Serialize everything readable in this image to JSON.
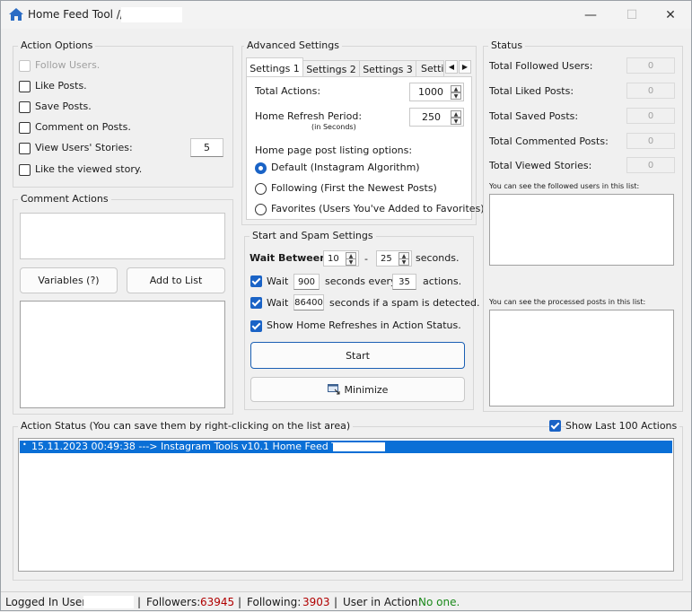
{
  "window": {
    "title": "Home Feed Tool // ",
    "icon": "home-icon",
    "minimize": "—",
    "maximize": "☐",
    "close": "✕"
  },
  "action_options": {
    "title": "Action Options",
    "follow_users": "Follow Users.",
    "like_posts": "Like Posts.",
    "save_posts": "Save Posts.",
    "comment_posts": "Comment on Posts.",
    "view_stories": "View Users' Stories:",
    "stories_count": "5",
    "like_viewed_story": "Like the viewed story."
  },
  "comment_actions": {
    "title": "Comment Actions",
    "variables_button": "Variables (?)",
    "add_to_list_button": "Add to List"
  },
  "advanced": {
    "title": "Advanced Settings",
    "tabs": [
      "Settings 1",
      "Settings 2",
      "Settings 3",
      "Setti"
    ],
    "total_actions_label": "Total Actions:",
    "total_actions_value": "1000",
    "home_refresh_label": "Home Refresh Period:",
    "home_refresh_sub": "(in Seconds)",
    "home_refresh_value": "250",
    "listing_label": "Home page post listing options:",
    "opt_default": "Default (Instagram Algorithm)",
    "opt_following": "Following (First the Newest Posts)",
    "opt_favorites": "Favorites (Users You've Added to Favorites)"
  },
  "spam": {
    "title": "Start and Spam Settings",
    "wait_between": "Wait Between:",
    "min": "10",
    "dash": "-",
    "max": "25",
    "seconds": "seconds.",
    "wait1": "Wait",
    "wait1_value": "900",
    "every": "seconds every",
    "every_value": "35",
    "actions": "actions.",
    "wait2": "Wait",
    "wait2_value": "86400",
    "spam_text": "seconds if a spam is detected.",
    "show_refreshes": "Show Home Refreshes in Action Status.",
    "start_button": "Start",
    "minimize_button": "Minimize"
  },
  "status": {
    "title": "Status",
    "followed_label": "Total Followed Users:",
    "followed": "0",
    "liked_label": "Total Liked Posts:",
    "liked": "0",
    "saved_label": "Total Saved Posts:",
    "saved": "0",
    "commented_label": "Total Commented Posts:",
    "commented": "0",
    "viewed_label": "Total Viewed Stories:",
    "viewed": "0",
    "followed_list_caption": "You can see the followed users in this list:",
    "processed_list_caption": "You can see the processed posts in this list:"
  },
  "action_status": {
    "title": "Action Status (You can save them by right-clicking on the list area)",
    "show_last": "Show Last 100 Actions",
    "entries": [
      "15.11.2023 00:49:38 ---> Instagram Tools v10.1 Home Feed Tool // "
    ]
  },
  "statusbar": {
    "logged_label": "Logged In User:",
    "sep": "|",
    "followers_label": "Followers:",
    "followers": "63945",
    "following_label": "Following:",
    "following": "3903",
    "in_action_label": "User in Action:",
    "in_action": "No one."
  },
  "colors": {
    "accent": "#1a63c6",
    "selection": "#0a6fd6",
    "red_value": "#b00000",
    "green_value": "#1b8a1b"
  }
}
